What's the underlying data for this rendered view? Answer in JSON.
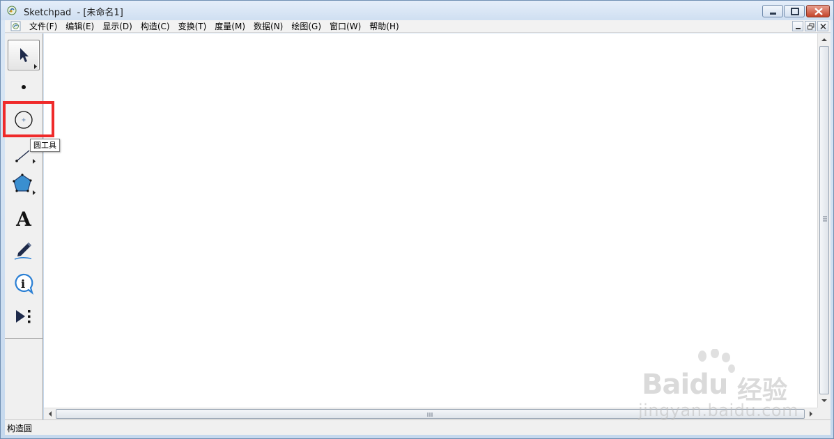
{
  "window": {
    "title": "Sketchpad  - [未命名1]"
  },
  "menu": {
    "items": [
      {
        "label": "文件(F)"
      },
      {
        "label": "编辑(E)"
      },
      {
        "label": "显示(D)"
      },
      {
        "label": "构造(C)"
      },
      {
        "label": "变换(T)"
      },
      {
        "label": "度量(M)"
      },
      {
        "label": "数据(N)"
      },
      {
        "label": "绘图(G)"
      },
      {
        "label": "窗口(W)"
      },
      {
        "label": "帮助(H)"
      }
    ]
  },
  "toolbox": {
    "tools": [
      {
        "name": "selection-arrow-tool",
        "icon": "arrow-pointer-icon",
        "selected": true
      },
      {
        "name": "point-tool",
        "icon": "point-icon"
      },
      {
        "name": "compass-tool",
        "icon": "circle-icon",
        "highlighted": true
      },
      {
        "name": "straightedge-tool",
        "icon": "line-segment-icon"
      },
      {
        "name": "polygon-tool",
        "icon": "pentagon-icon"
      },
      {
        "name": "text-tool",
        "icon": "letter-a-icon"
      },
      {
        "name": "marker-tool",
        "icon": "marker-pen-icon"
      },
      {
        "name": "information-tool",
        "icon": "info-icon"
      },
      {
        "name": "custom-tool",
        "icon": "play-dots-icon"
      }
    ],
    "tooltip": "圆工具"
  },
  "status": {
    "text": "构造圆"
  },
  "watermark": {
    "brand": "Bai",
    "brand_du": "du",
    "cn": "经验",
    "url": "jingyan.baidu.com"
  },
  "colors": {
    "highlight": "#ef2a2a",
    "polygon_fill": "#3a8fd0",
    "info_blue": "#2a7fd4"
  }
}
